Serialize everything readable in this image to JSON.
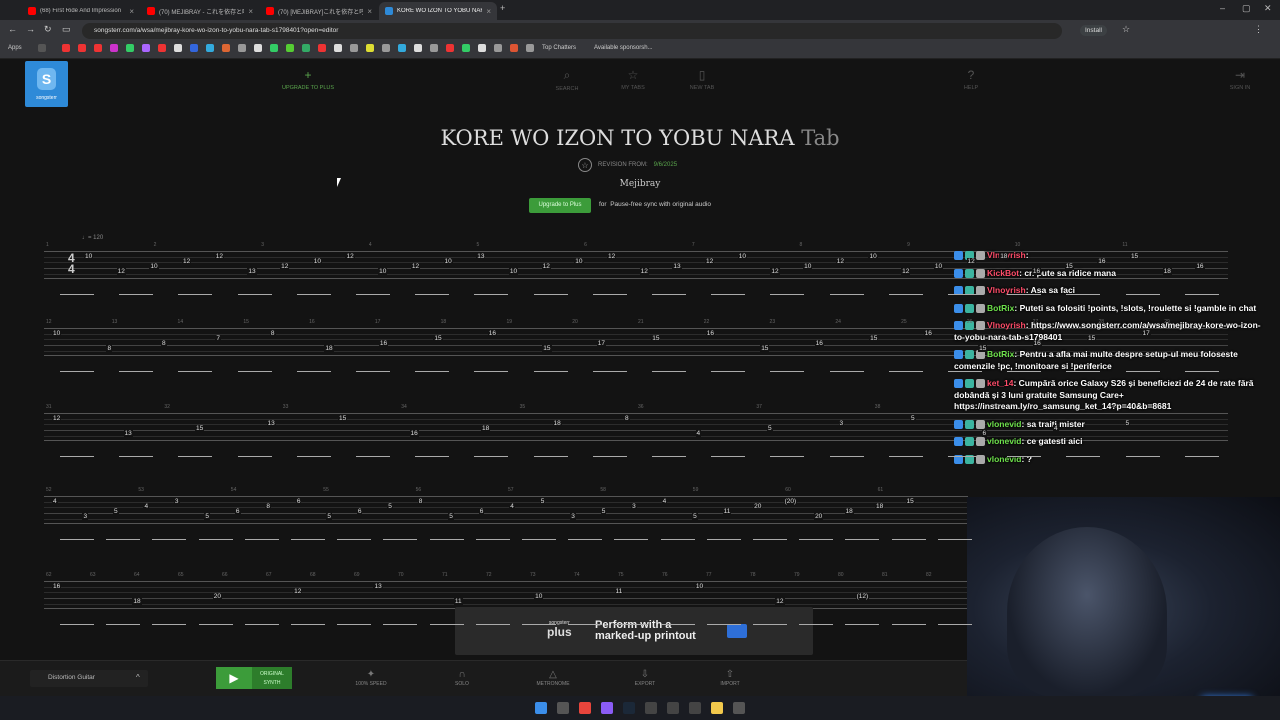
{
  "browser": {
    "tabs": [
      {
        "title": "(68) First Ride And Impression",
        "color": "#ff0000",
        "active": false
      },
      {
        "title": "(70) MEJIBRAY - これを依存と呼",
        "color": "#ff0000",
        "active": false
      },
      {
        "title": "(70) [MEJIBRAY]これを依存と呼",
        "color": "#ff0000",
        "active": false
      },
      {
        "title": "KORE WO IZON TO YOBU NARA",
        "color": "#2e8ad8",
        "active": true
      }
    ],
    "url": "songsterr.com/a/wsa/mejibray-kore-wo-izon-to-yobu-nara-tab-s1798401?open=editor",
    "install_label": "Install",
    "bookmarks": {
      "apps": "Apps",
      "top_chatters": "Top Chatters",
      "available_sponsorships": "Available sponsorsh..."
    }
  },
  "site": {
    "logo_text": "songsterr",
    "nav": {
      "upgrade": "UPGRADE TO PLUS",
      "search": "SEARCH",
      "my_tabs": "MY TABS",
      "new_tab": "NEW TAB",
      "help": "HELP",
      "sign_in": "SIGN IN"
    },
    "title_main": "KORE WO IZON TO YOBU NARA",
    "title_kind": "Tab",
    "revision_label": "REVISION FROM:",
    "revision_date": "9/6/2025",
    "artist": "Mejibray",
    "upgrade_button": "Upgrade to Plus",
    "upgrade_for": "for",
    "upgrade_text": "Pause-free sync with original audio",
    "tempo": "♩= 120",
    "time_sig_top": "4",
    "time_sig_bottom": "4"
  },
  "staffs": [
    {
      "bars": [
        "1",
        "2",
        "3",
        "4",
        "5",
        "6",
        "7",
        "8",
        "9",
        "10",
        "11"
      ],
      "frets": [
        "10",
        "12",
        "10",
        "12",
        "12",
        "13",
        "12",
        "10",
        "12",
        "10",
        "12",
        "10",
        "13",
        "10",
        "12",
        "10",
        "12",
        "12",
        "13",
        "12",
        "10",
        "12",
        "10",
        "12",
        "10",
        "12",
        "10",
        "12",
        "18",
        "16",
        "15",
        "16",
        "15",
        "18",
        "16"
      ]
    },
    {
      "bars": [
        "12",
        "13",
        "14",
        "15",
        "16",
        "17",
        "18",
        "19",
        "20",
        "21",
        "22",
        "23",
        "24",
        "25",
        "26",
        "27",
        "28",
        "29"
      ],
      "frets": [
        "10",
        "8",
        "8",
        "7",
        "8",
        "18",
        "16",
        "15",
        "16",
        "15",
        "17",
        "15",
        "16",
        "15",
        "16",
        "15",
        "16",
        "15",
        "16",
        "15",
        "17"
      ]
    },
    {
      "bars": [
        "31",
        "32",
        "33",
        "34",
        "35",
        "36",
        "37",
        "38",
        "39",
        "40"
      ],
      "frets": [
        "12",
        "13",
        "15",
        "13",
        "15",
        "16",
        "18",
        "18",
        "8",
        "4",
        "5",
        "3",
        "5",
        "6",
        "4",
        "5"
      ]
    },
    {
      "bars": [
        "52",
        "53",
        "54",
        "55",
        "56",
        "57",
        "58",
        "59",
        "60",
        "61"
      ],
      "frets": [
        "4",
        "3",
        "5",
        "4",
        "3",
        "5",
        "6",
        "8",
        "6",
        "5",
        "6",
        "5",
        "8",
        "5",
        "6",
        "4",
        "5",
        "3",
        "5",
        "3",
        "4",
        "5",
        "11",
        "20",
        "(20)",
        "20",
        "18",
        "18",
        "15"
      ]
    },
    {
      "bars": [
        "62",
        "63",
        "64",
        "65",
        "66",
        "67",
        "68",
        "69",
        "70",
        "71",
        "72",
        "73",
        "74",
        "75",
        "76",
        "77",
        "78",
        "79",
        "80",
        "81",
        "82"
      ],
      "frets": [
        "16",
        "18",
        "20",
        "12",
        "13",
        "11",
        "10",
        "11",
        "10",
        "12",
        "(12)"
      ]
    }
  ],
  "chat": [
    {
      "user": "Vlnoyrish",
      "user_color": "#ff4d6a",
      "text": ""
    },
    {
      "user": "KickBot",
      "user_color": "#ff4d6a",
      "text": "cn pute sa ridice mana"
    },
    {
      "user": "Vlnoyrish",
      "user_color": "#ff4d6a",
      "text": "Asa sa faci"
    },
    {
      "user": "BotRix",
      "user_color": "#6ee24c",
      "text": "Puteti sa folositi !points, !slots, !roulette si !gamble in chat"
    },
    {
      "user": "Vlnoyrish",
      "user_color": "#ff4d6a",
      "text": "https://www.songsterr.com/a/wsa/mejibray-kore-wo-izon-to-yobu-nara-tab-s1798401"
    },
    {
      "user": "BotRix",
      "user_color": "#6ee24c",
      "text": "Pentru a afla mai multe despre setup-ul meu foloseste comenzile !pc, !monitoare si !periferice"
    },
    {
      "user": "ket_14",
      "user_color": "#ff4d6a",
      "text": "Cumpără orice Galaxy S26 și beneficiezi de 24 de rate fără dobândă și 3 luni gratuite Samsung Care+ https://instream.ly/ro_samsung_ket_14?p=40&b=8681"
    },
    {
      "user": "vlonevid",
      "user_color": "#6ee24c",
      "text": "sa traiti mister"
    },
    {
      "user": "vlonevid",
      "user_color": "#6ee24c",
      "text": "ce gatesti aici"
    },
    {
      "user": "vlonevid",
      "user_color": "#6ee24c",
      "text": "?"
    }
  ],
  "ad": {
    "logo_top": "songsterr",
    "logo_bottom": "plus",
    "line1": "Perform with a",
    "line2": "marked-up printout"
  },
  "player": {
    "instrument": "Distortion Guitar",
    "original_label": "ORIGINAL",
    "synth_label": "SYNTH",
    "speed_value": "100%",
    "speed_label": "SPEED",
    "solo_label": "SOLO",
    "metronome_label": "METRONOME",
    "export_label": "EXPORT",
    "import_label": "IMPORT"
  }
}
